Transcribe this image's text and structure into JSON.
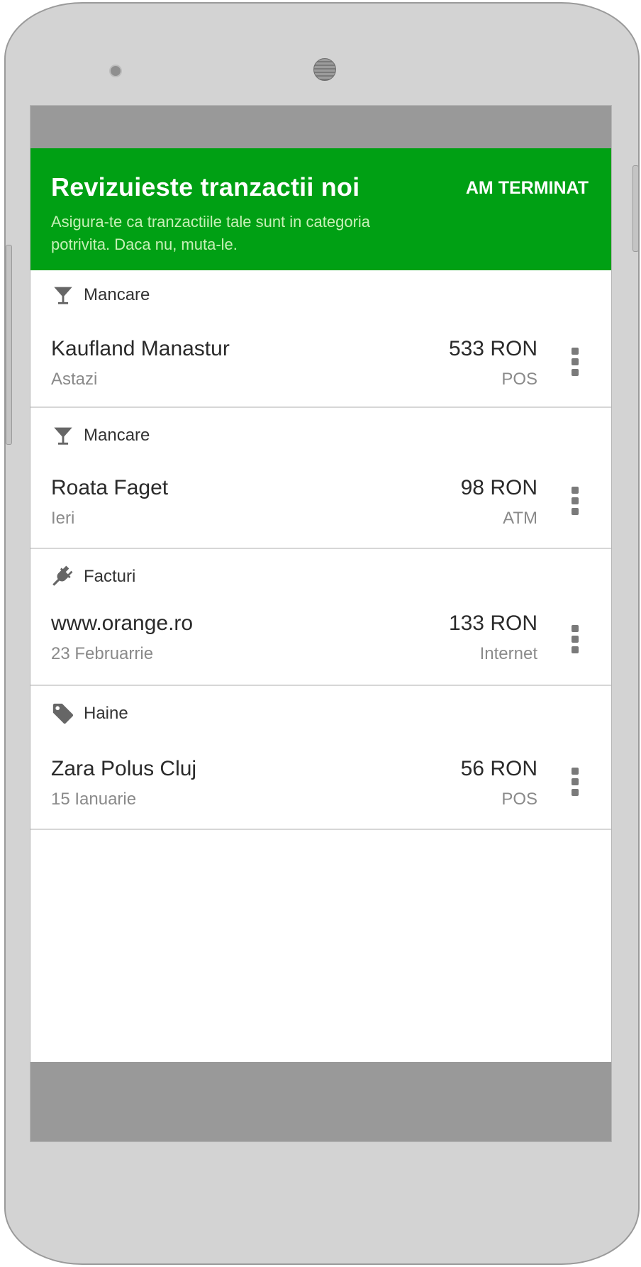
{
  "header": {
    "title": "Revizuieste tranzactii noi",
    "subtitle": "Asigura-te ca tranzactiile tale sunt in categoria potrivita. Daca nu, muta-le.",
    "done_label": "AM TERMINAT"
  },
  "colors": {
    "header_bg": "#00a014",
    "status_bar": "#999999",
    "phone_body": "#d3d3d3"
  },
  "transactions": [
    {
      "category": "Mancare",
      "category_icon": "cocktail-icon",
      "merchant": "Kaufland Manastur",
      "date": "Astazi",
      "amount": "533 RON",
      "method": "POS"
    },
    {
      "category": "Mancare",
      "category_icon": "cocktail-icon",
      "merchant": "Roata Faget",
      "date": "Ieri",
      "amount": "98 RON",
      "method": "ATM"
    },
    {
      "category": "Facturi",
      "category_icon": "plug-icon",
      "merchant": "www.orange.ro",
      "date": "23 Februarrie",
      "amount": "133 RON",
      "method": "Internet"
    },
    {
      "category": "Haine",
      "category_icon": "tag-icon",
      "merchant": "Zara Polus Cluj",
      "date": "15 Ianuarie",
      "amount": "56 RON",
      "method": "POS"
    }
  ]
}
